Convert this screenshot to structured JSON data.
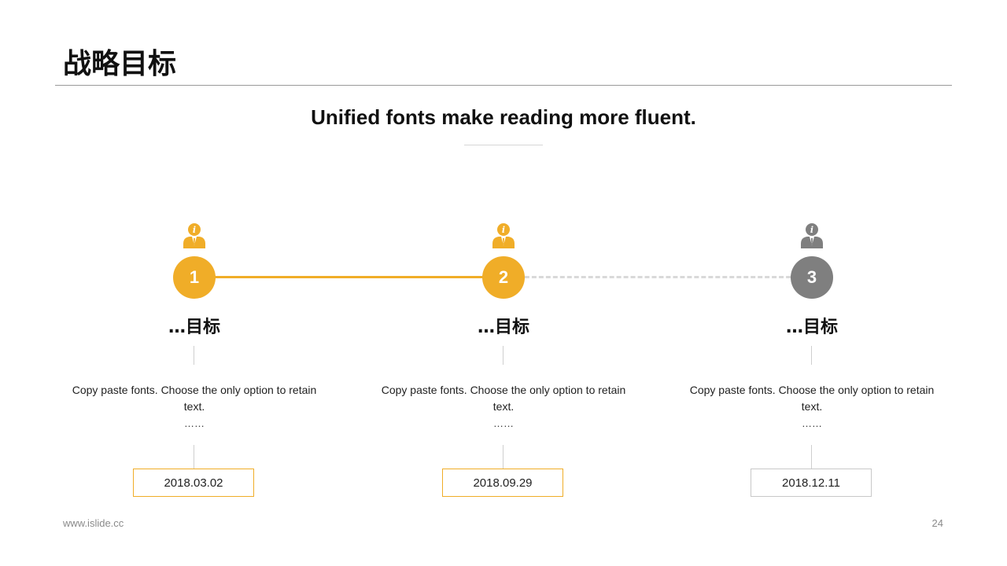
{
  "title": "战略目标",
  "subtitle": "Unified fonts make reading more fluent.",
  "colors": {
    "accent": "#f0ad28",
    "muted": "#7f7f7f",
    "dashed": "#d9d9d9"
  },
  "steps": [
    {
      "number": "1",
      "heading": "…目标",
      "description": "Copy paste fonts. Choose the only option to retain text.",
      "ellipsis": "……",
      "date": "2018.03.02",
      "icon": "person-info-icon",
      "state": "active"
    },
    {
      "number": "2",
      "heading": "…目标",
      "description": "Copy paste fonts. Choose the only option to retain text.",
      "ellipsis": "……",
      "date": "2018.09.29",
      "icon": "person-info-icon",
      "state": "active"
    },
    {
      "number": "3",
      "heading": "…目标",
      "description": "Copy paste fonts. Choose the only option to retain text.",
      "ellipsis": "……",
      "date": "2018.12.11",
      "icon": "person-info-icon",
      "state": "inactive"
    }
  ],
  "footer": {
    "url": "www.islide.cc",
    "page": "24"
  }
}
